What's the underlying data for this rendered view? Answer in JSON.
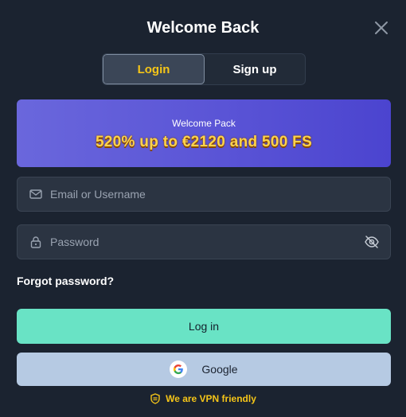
{
  "header": {
    "title": "Welcome Back"
  },
  "tabs": [
    {
      "label": "Login",
      "active": true
    },
    {
      "label": "Sign up",
      "active": false
    }
  ],
  "promo": {
    "subtitle": "Welcome Pack",
    "offer": "520% up to €2120 and 500 FS"
  },
  "form": {
    "email_placeholder": "Email or Username",
    "email_value": "",
    "password_placeholder": "Password",
    "password_value": "",
    "forgot_label": "Forgot password?",
    "login_label": "Log in",
    "google_label": "Google"
  },
  "footer": {
    "vpn_text": "We are VPN friendly"
  },
  "icons": {
    "close": "close-icon",
    "email": "mail-icon",
    "password": "lock-icon",
    "visibility": "eye-off-icon",
    "google": "google-icon",
    "vpn": "shield-icon"
  },
  "colors": {
    "background": "#1b2330",
    "accent_yellow": "#f5c518",
    "login_button": "#69e3c5",
    "google_button": "#b6cae3",
    "promo_gradient": [
      "#6a67dc",
      "#4b44cf"
    ]
  }
}
